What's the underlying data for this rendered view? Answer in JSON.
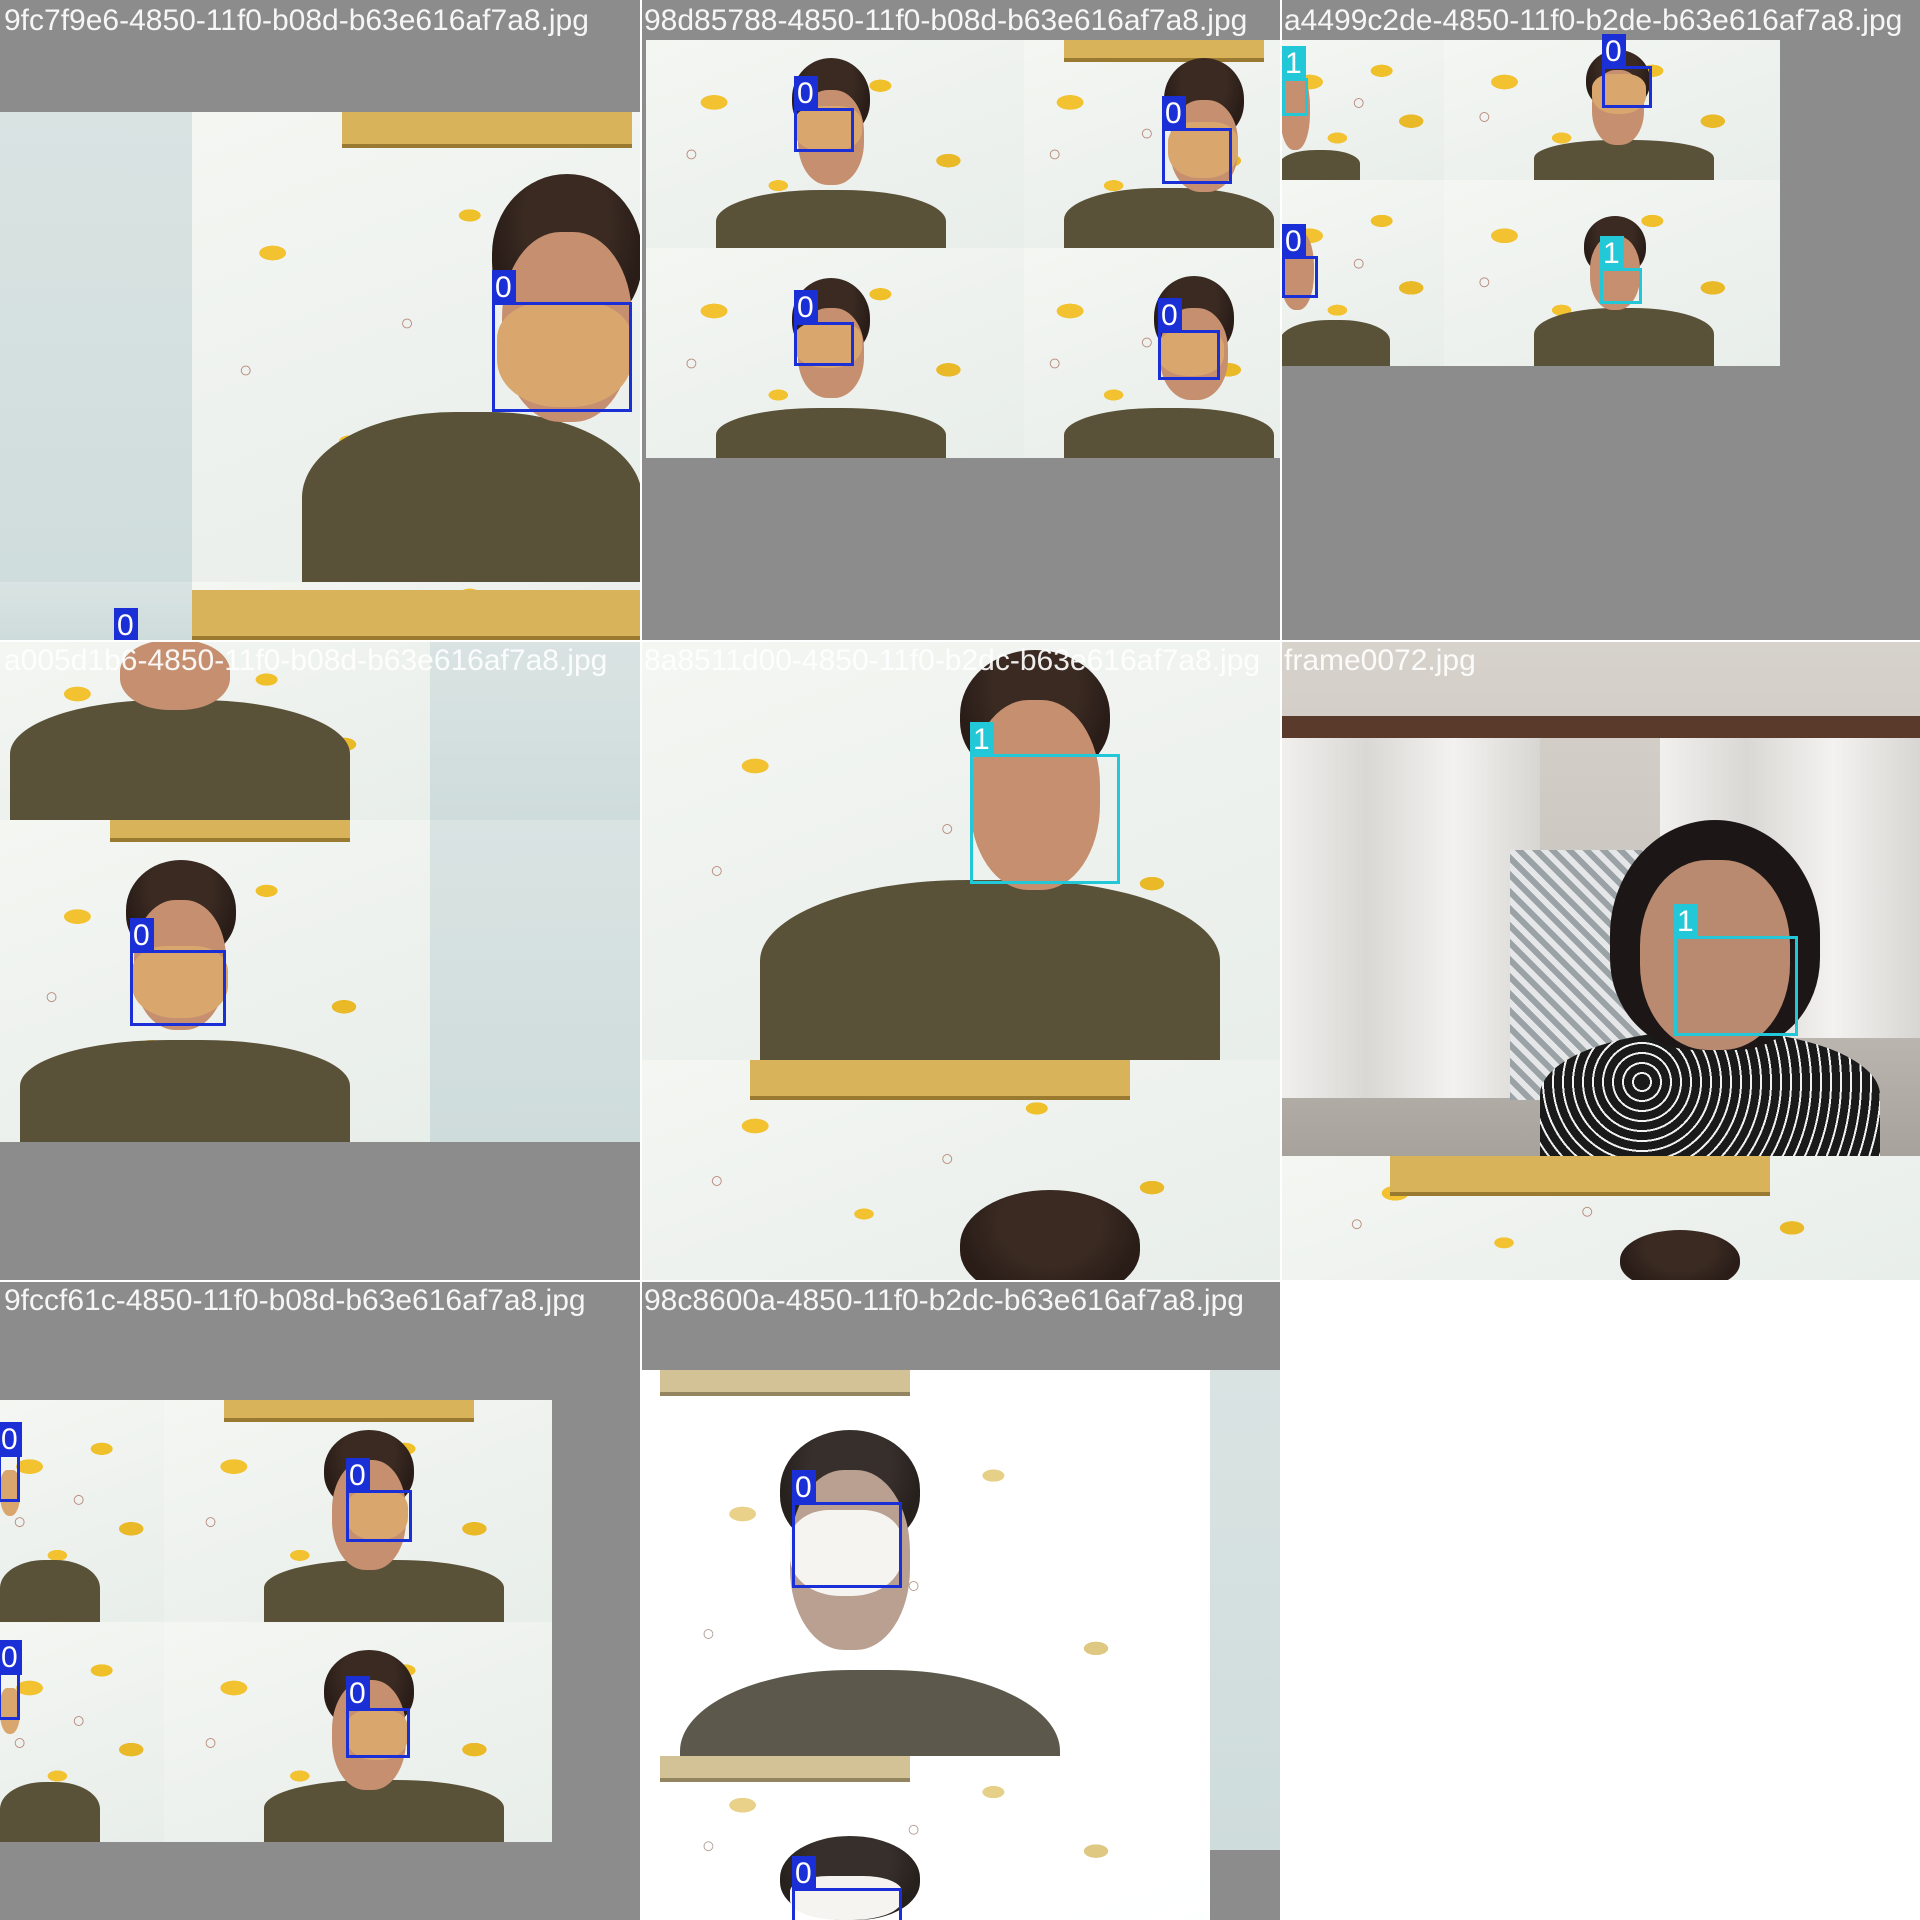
{
  "tiles": [
    {
      "caption": "9fc7f9e6-4850-11f0-b08d-b63e616af7a8.jpg",
      "boxes": [
        {
          "label": "0"
        },
        {
          "label": "0"
        }
      ]
    },
    {
      "caption": "98d85788-4850-11f0-b08d-b63e616af7a8.jpg",
      "boxes": [
        {
          "label": "0"
        },
        {
          "label": "0"
        },
        {
          "label": "0"
        },
        {
          "label": "0"
        }
      ]
    },
    {
      "caption": "a4499c2de-4850-11f0-b2de-b63e616af7a8.jpg",
      "boxes": [
        {
          "label": "1"
        },
        {
          "label": "0"
        },
        {
          "label": "0"
        },
        {
          "label": "1"
        }
      ]
    },
    {
      "caption": "a005d1b6-4850-11f0-b08d-b63e616af7a8.jpg",
      "boxes": [
        {
          "label": "0"
        }
      ]
    },
    {
      "caption": "8a8511d00-4850-11f0-b2dc-b63e616af7a8.jpg",
      "boxes": [
        {
          "label": "1"
        }
      ]
    },
    {
      "caption": "frame0072.jpg",
      "boxes": [
        {
          "label": "1"
        }
      ]
    },
    {
      "caption": "9fccf61c-4850-11f0-b08d-b63e616af7a8.jpg",
      "boxes": [
        {
          "label": "0"
        },
        {
          "label": "0"
        },
        {
          "label": "0"
        },
        {
          "label": "0"
        }
      ]
    },
    {
      "caption": "98c8600a-4850-11f0-b2dc-b63e616af7a8.jpg",
      "boxes": [
        {
          "label": "0"
        },
        {
          "label": "0"
        }
      ]
    }
  ],
  "colors": {
    "class_0": "#1a2fd6",
    "class_1": "#22c8d8",
    "padding": "#8c8c8c"
  }
}
